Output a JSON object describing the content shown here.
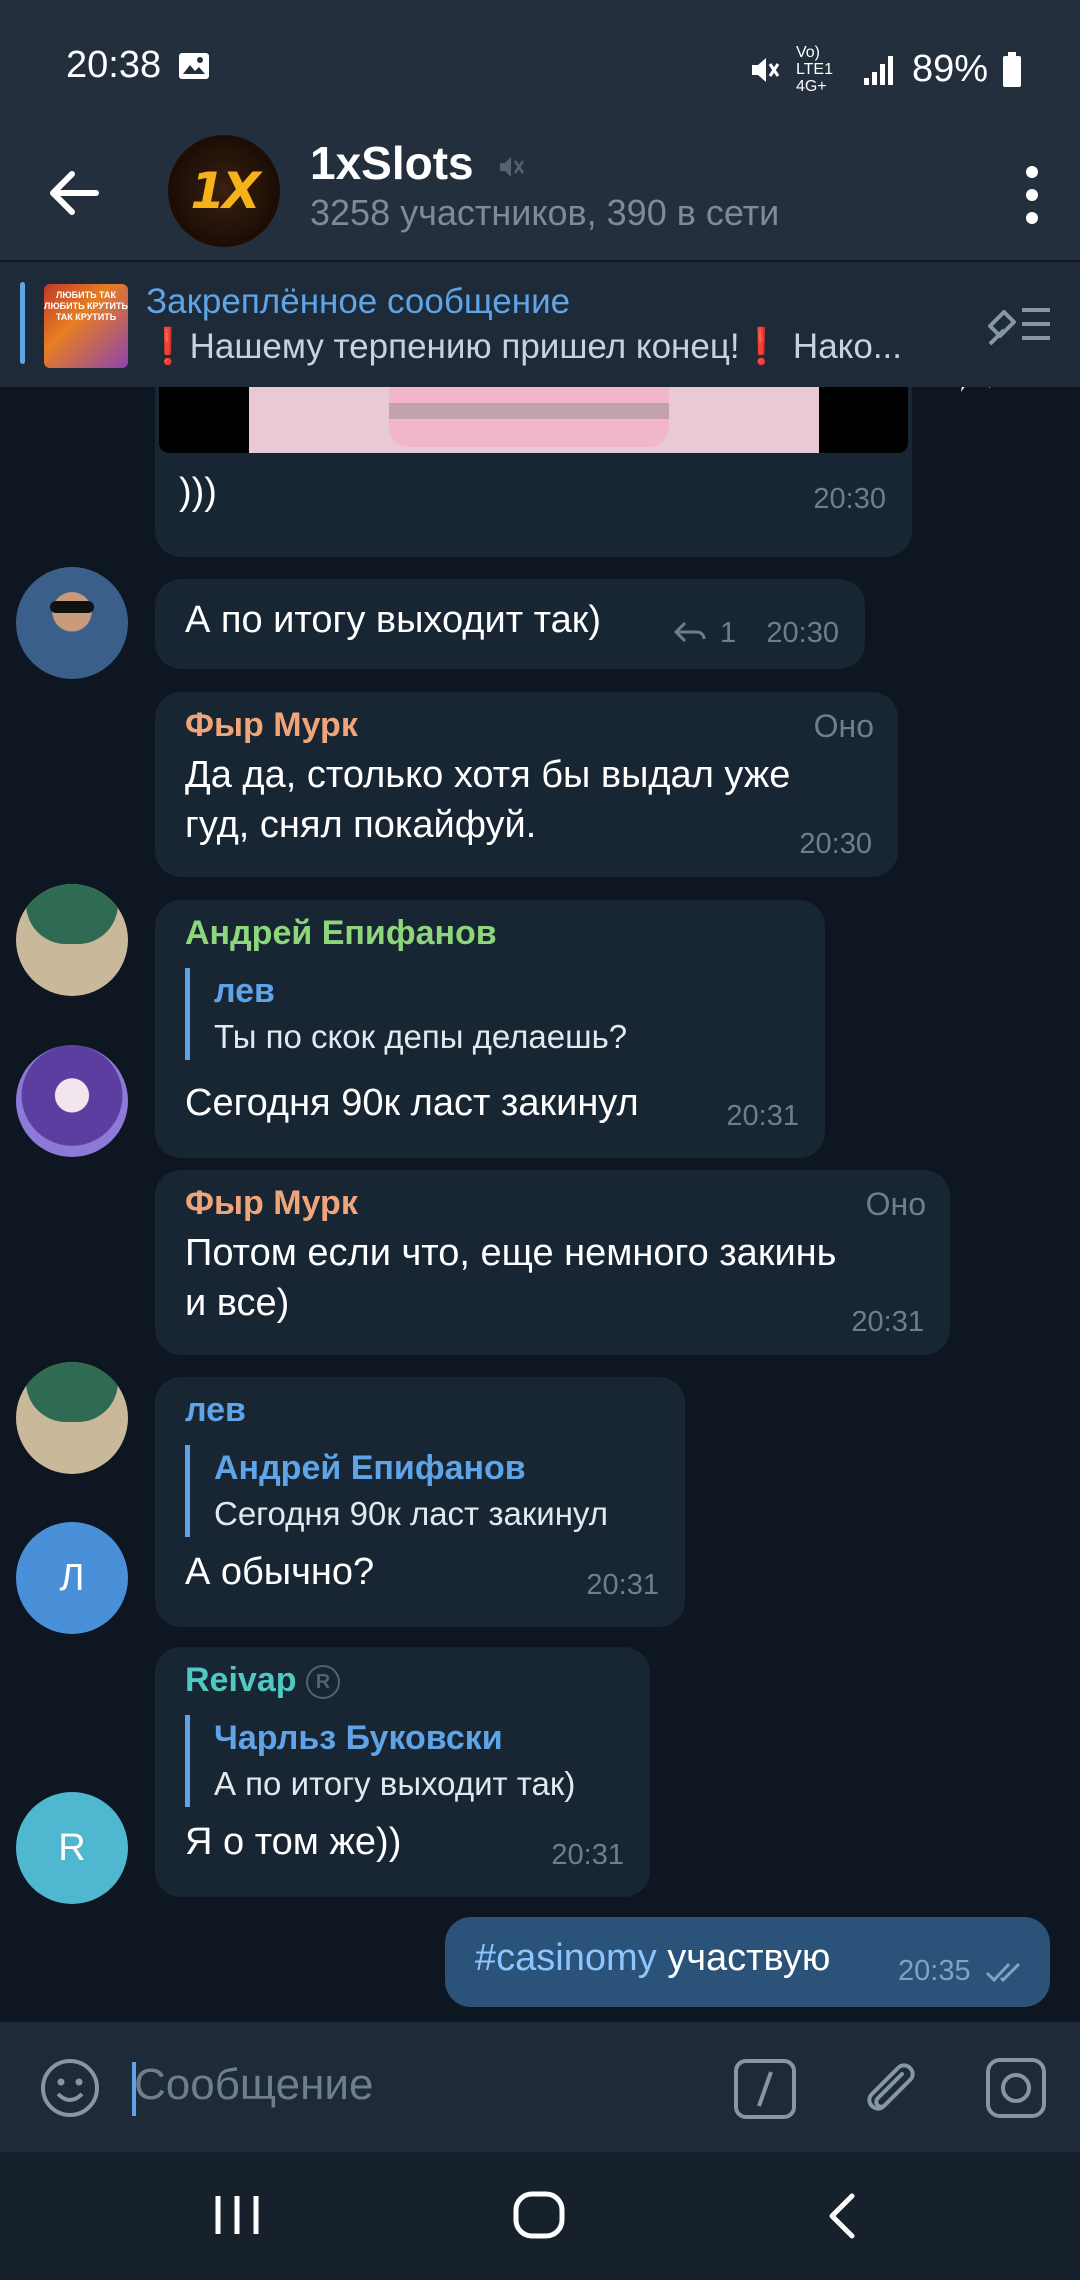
{
  "status_bar": {
    "time": "20:38",
    "network": "Vo) LTE1 4G+",
    "battery": "89%"
  },
  "header": {
    "title": "1xSlots",
    "subtitle": "3258 участников, 390 в сети",
    "avatar_text": "1X"
  },
  "pinned": {
    "title": "Закреплённое сообщение",
    "text": "❗️Нашему терпению пришел конец!❗️ Нако...",
    "thumb_text": "ЛЮБИТЬ ТАК ЛЮБИТЬ КРУТИТЬ ТАК КРУТИТЬ"
  },
  "messages": [
    {
      "text": ")))",
      "time": "20:30"
    },
    {
      "text": "А по итогу выходит так)",
      "replies": "1",
      "time": "20:30"
    },
    {
      "sender": "Фыр Мурк",
      "role": "Оно",
      "line1": "Да да, столько хотя бы выдал уже",
      "line2": "гуд, снял покайфуй.",
      "time": "20:30"
    },
    {
      "sender": "Андрей Епифанов",
      "quote_name": "лев",
      "quote_text": "Ты по скок депы делаешь?",
      "text": "Сегодня 90к ласт закинул",
      "time": "20:31"
    },
    {
      "sender": "Фыр Мурк",
      "role": "Оно",
      "line1": "Потом если что, еще немного закинь",
      "line2": "и все)",
      "time": "20:31"
    },
    {
      "sender": "лев",
      "quote_name": "Андрей Епифанов",
      "quote_text": "Сегодня 90к ласт закинул",
      "text": "А обычно?",
      "time": "20:31",
      "avatar_letter": "Л"
    },
    {
      "sender": "Reivap",
      "quote_name": "Чарльз Буковски",
      "quote_text": "А по итогу выходит так)",
      "text": "Я о том же))",
      "time": "20:31",
      "avatar_letter": "R"
    },
    {
      "hashtag": "#casinomy",
      "text": " участвую",
      "time": "20:35"
    }
  ],
  "input": {
    "placeholder": "Сообщение"
  },
  "colors": {
    "accent": "#5fa4e6",
    "bubble_in": "#182533",
    "bubble_out": "#2b5278",
    "name_orange": "#f0a479",
    "name_green": "#8ed67c",
    "name_blue": "#5fa4e6",
    "name_teal": "#4fc9c1",
    "avatar_l": "#4a90d9",
    "avatar_r": "#4fb8d0"
  }
}
